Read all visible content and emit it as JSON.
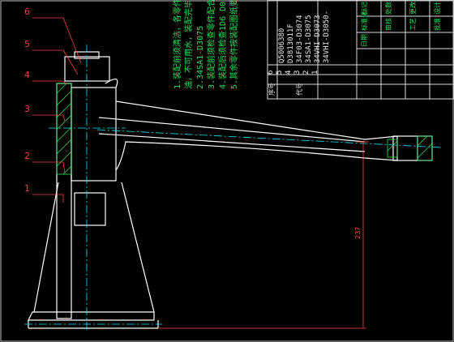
{
  "callouts": [
    "6",
    "5",
    "4",
    "3",
    "2",
    "1"
  ],
  "notes": [
    "1.装配前须清洁，各零件须清洗",
    "油，不可用水，装配完毕须清洗",
    "2.34SA1-D3075",
    "3.装配前须检查零件配合尺寸",
    "4.装配后须检查1D6 D0",
    "5.其余零件按装配图纸要求执行"
  ],
  "bom_rows": [
    {
      "no": "6",
      "code": "Q5006380"
    },
    {
      "no": "5",
      "code": "D3813011F"
    },
    {
      "no": "4",
      "code": "34F03-D3074"
    },
    {
      "no": "3",
      "code": "34SA1-D3075"
    },
    {
      "no": "2",
      "code": "34VHI-D3073"
    },
    {
      "no": "1",
      "code": "34VHI-D3050-"
    }
  ],
  "bom_header": {
    "seq": "序号",
    "code": "代号"
  },
  "title_block": [
    "标记",
    "处数",
    "更改文件号",
    "设计",
    "标准化",
    "审核",
    "工艺",
    "批准",
    "日期"
  ],
  "dimension": "237",
  "colors": {
    "background": "#000000",
    "outline": "#ffffff",
    "centerline": "#00e5ff",
    "hatch": "#27e05a",
    "callout": "#ff3b3b"
  }
}
